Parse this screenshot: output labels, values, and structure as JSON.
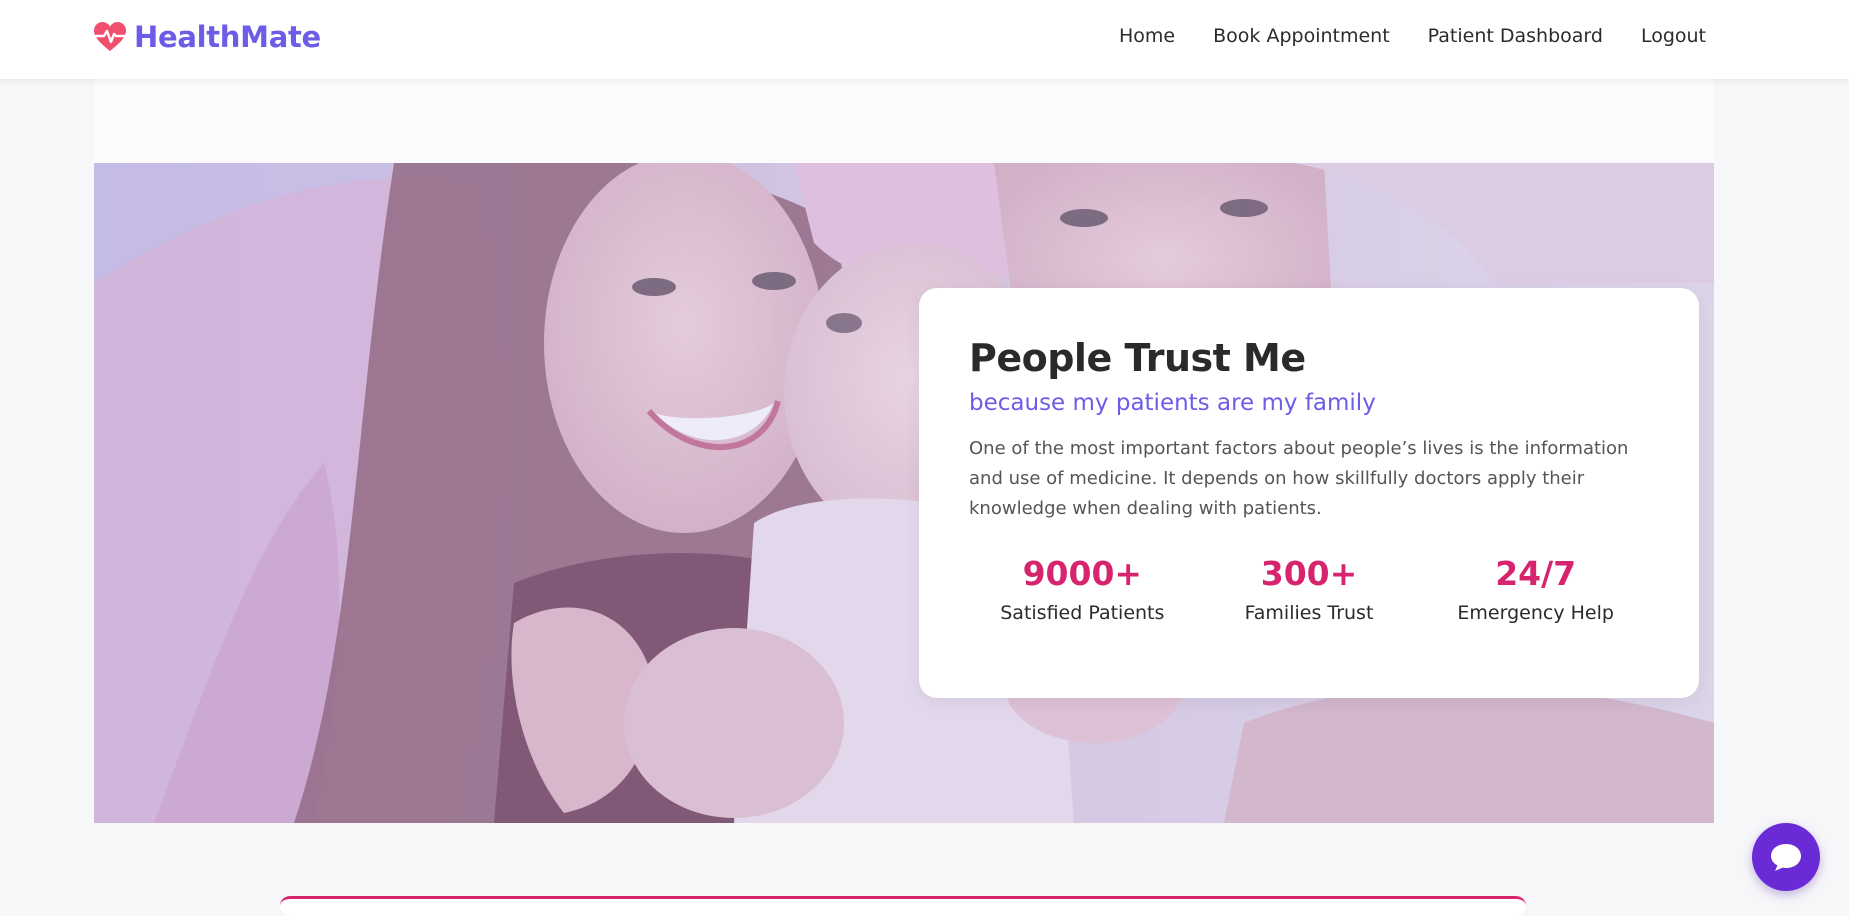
{
  "brand": {
    "name": "HealthMate",
    "icon": "heart-pulse-icon",
    "color": "#6c5ce7",
    "icon_color": "#f0506e"
  },
  "nav": {
    "items": [
      {
        "label": "Home"
      },
      {
        "label": "Book Appointment"
      },
      {
        "label": "Patient Dashboard"
      },
      {
        "label": "Logout"
      }
    ]
  },
  "hero": {
    "image": "family-photo",
    "card": {
      "title": "People Trust Me",
      "subtitle": "because my patients are my family",
      "text": "One of the most important factors about people’s lives is the information and use of medicine. It depends on how skillfully doctors apply their knowledge when dealing with patients.",
      "stats": [
        {
          "value": "9000+",
          "label": "Satisfied Patients"
        },
        {
          "value": "300+",
          "label": "Families Trust"
        },
        {
          "value": "24/7",
          "label": "Emergency Help"
        }
      ]
    }
  },
  "chat": {
    "icon": "chat-bubble-icon",
    "color": "#6a2bd6"
  },
  "colors": {
    "accent": "#6c5ce7",
    "stat": "#d6246e",
    "text": "#2b2b2b"
  }
}
